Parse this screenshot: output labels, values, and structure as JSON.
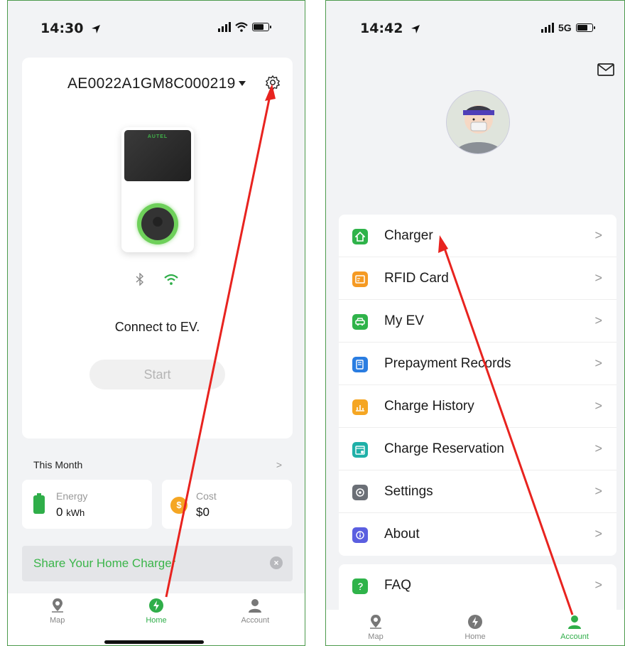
{
  "left": {
    "status": {
      "time": "14:30"
    },
    "charger_id": "AE0022A1GM8C000219",
    "brand": "AUTEL",
    "connection_status": "Connect to EV.",
    "start_label": "Start",
    "month_label": "This Month",
    "energy": {
      "label": "Energy",
      "value": "0",
      "unit": "kWh"
    },
    "cost": {
      "label": "Cost",
      "value": "$0",
      "symbol": "$"
    },
    "share_label": "Share Your Home Charger",
    "tabs": [
      {
        "label": "Map"
      },
      {
        "label": "Home"
      },
      {
        "label": "Account"
      }
    ]
  },
  "right": {
    "status": {
      "time": "14:42",
      "network": "5G"
    },
    "menu": [
      {
        "label": "Charger",
        "icon": "home-icon",
        "color": "#2fb34a"
      },
      {
        "label": "RFID Card",
        "icon": "card-icon",
        "color": "#f59a23"
      },
      {
        "label": "My EV",
        "icon": "car-icon",
        "color": "#2fb34a"
      },
      {
        "label": "Prepayment Records",
        "icon": "receipt-icon",
        "color": "#2a7de1"
      },
      {
        "label": "Charge History",
        "icon": "bar-chart-icon",
        "color": "#f5a623"
      },
      {
        "label": "Charge Reservation",
        "icon": "calendar-icon",
        "color": "#1fb0a8"
      },
      {
        "label": "Settings",
        "icon": "gear-icon",
        "color": "#6b6f76"
      },
      {
        "label": "About",
        "icon": "info-icon",
        "color": "#5b5fe0"
      }
    ],
    "faq_label": "FAQ",
    "chevron": ">",
    "tabs": [
      {
        "label": "Map"
      },
      {
        "label": "Home"
      },
      {
        "label": "Account"
      }
    ]
  },
  "colors": {
    "accent_green": "#2fae49",
    "arrow_red": "#e8231f"
  }
}
